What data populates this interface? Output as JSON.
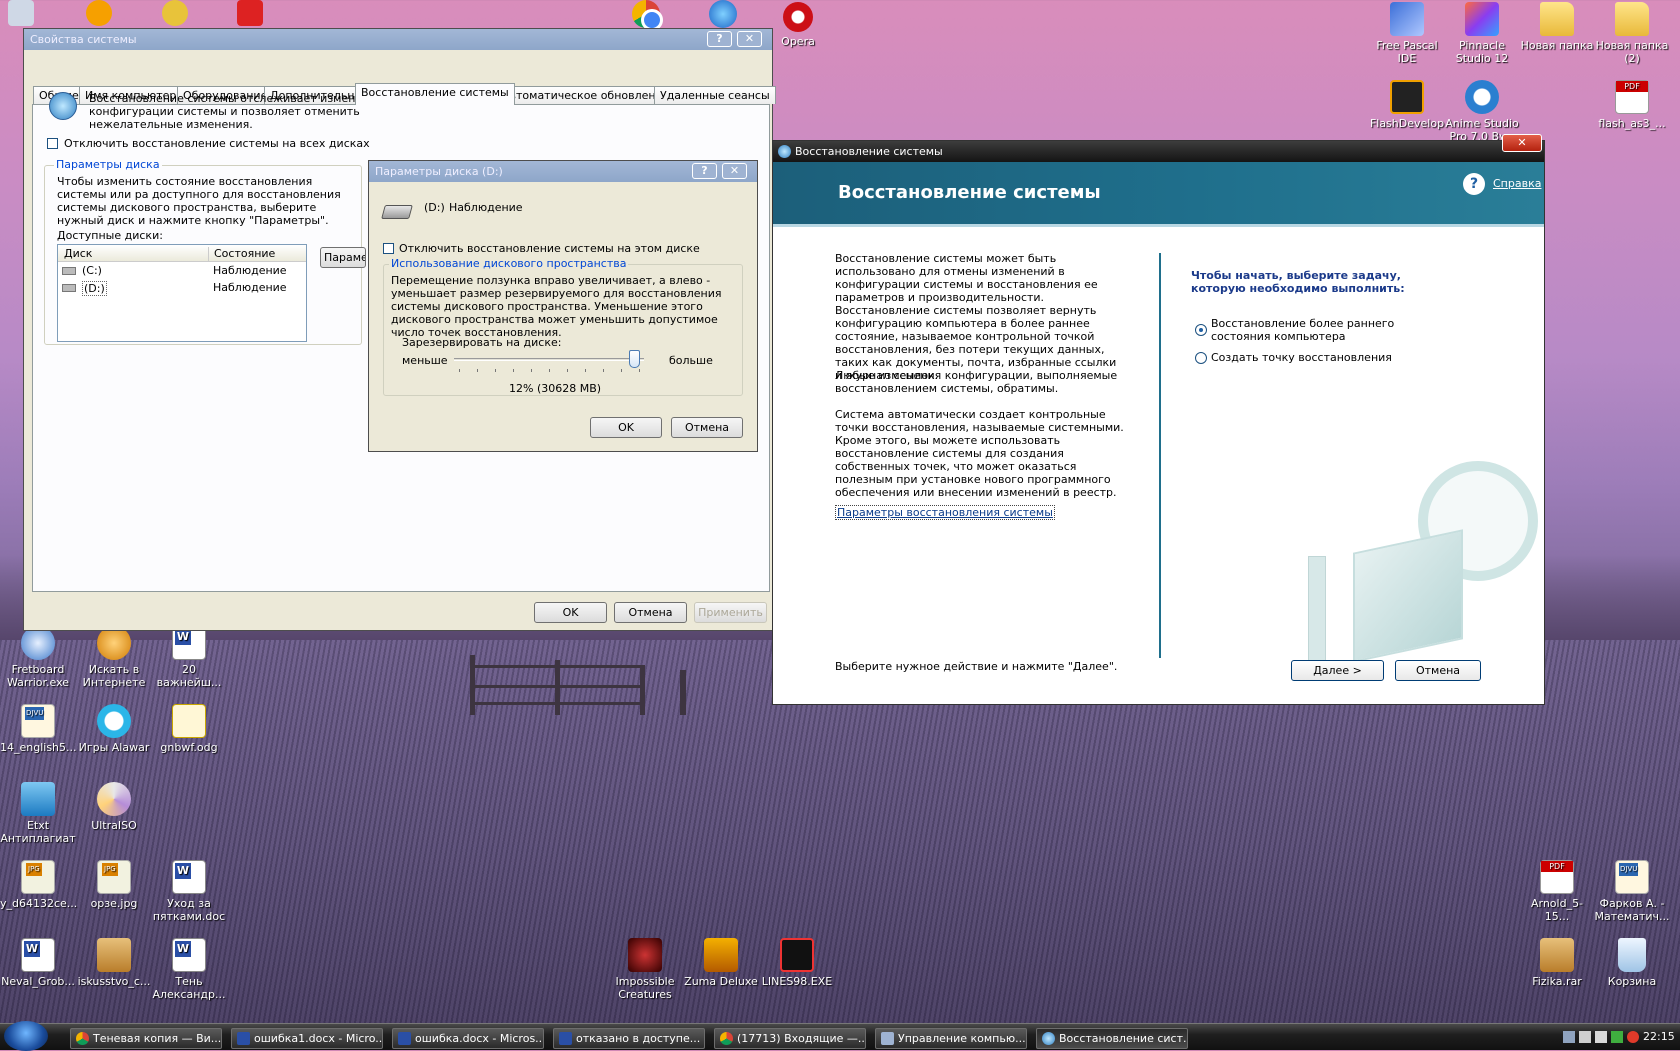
{
  "desktop": {
    "left_icons": [
      {
        "label": "Fretboard Warrior.exe",
        "icon": "guitar-icon"
      },
      {
        "label": "Искать в Интернете",
        "icon": "search-icon"
      },
      {
        "label": "20 важнейш...",
        "icon": "word-doc-icon"
      },
      {
        "label": "14_english5...",
        "icon": "djvu-icon"
      },
      {
        "label": "Игры Alawar",
        "icon": "alawar-icon"
      },
      {
        "label": "gnbwf.odg",
        "icon": "odg-icon"
      },
      {
        "label": "Etxt Антиплагиат",
        "icon": "etxt-icon"
      },
      {
        "label": "UltraISO",
        "icon": "disc-icon"
      },
      {
        "label": "y_d64132ce...",
        "icon": "jpg-icon"
      },
      {
        "label": "орзе.jpg",
        "icon": "jpg-icon"
      },
      {
        "label": "Уход за пятками.doc",
        "icon": "word-doc-icon"
      },
      {
        "label": "Neval_Grob...",
        "icon": "word-doc-icon"
      },
      {
        "label": "iskusstvo_c...",
        "icon": "rar-icon"
      },
      {
        "label": "Тень Александр...",
        "icon": "word-doc-icon"
      }
    ],
    "middle_icons": [
      {
        "label": "Impossible Creatures",
        "icon": "game-icon"
      },
      {
        "label": "Zuma Deluxe",
        "icon": "zuma-icon"
      },
      {
        "label": "LINES98.EXE",
        "icon": "lines-icon"
      }
    ],
    "top_icons": [
      {
        "label": "Opera",
        "icon": "opera-icon"
      }
    ],
    "right_icons": [
      {
        "label": "Free Pascal IDE",
        "icon": "pascal-icon"
      },
      {
        "label": "Pinnacle Studio 12",
        "icon": "pinnacle-icon"
      },
      {
        "label": "Новая папка",
        "icon": "folder-icon"
      },
      {
        "label": "Новая папка (2)",
        "icon": "folder-icon"
      },
      {
        "label": "FlashDevelop",
        "icon": "flashdevelop-icon"
      },
      {
        "label": "Anime Studio Pro 7.0 By...",
        "icon": "anime-studio-icon"
      },
      {
        "label": "flash_as3_...",
        "icon": "pdf-icon"
      },
      {
        "label": "Arnold_5-15...",
        "icon": "pdf-icon"
      },
      {
        "label": "Фарков А. - Математич...",
        "icon": "djvu-icon"
      },
      {
        "label": "Fizika.rar",
        "icon": "rar-icon"
      },
      {
        "label": "Корзина",
        "icon": "recycle-bin-icon"
      }
    ]
  },
  "sysprops": {
    "title": "Свойства системы",
    "tabs": [
      "Общие",
      "Имя компьютера",
      "Оборудование",
      "Дополнительно",
      "Восстановление системы",
      "Автоматическое обновление",
      "Удаленные сеансы"
    ],
    "intro": "Восстановление системы отслеживает изменения конфигурации системы и позволяет отменить нежелательные изменения.",
    "disable_all": "Отключить восстановление системы на всех дисках",
    "group_title": "Параметры диска",
    "group_text": "Чтобы изменить состояние восстановления системы или ра доступного для восстановления системы дискового пространства, выберите нужный диск и нажмите кнопку \"Параметры\".",
    "available_label": "Доступные диски:",
    "col_disk": "Диск",
    "col_state": "Состояние",
    "rows": [
      {
        "disk": "(C:)",
        "state": "Наблюдение"
      },
      {
        "disk": "(D:)",
        "state": "Наблюдение"
      }
    ],
    "params_btn": "Параметр",
    "ok": "OK",
    "cancel": "Отмена",
    "apply": "Применить"
  },
  "diskdlg": {
    "title": "Параметры диска (D:)",
    "drive": "(D:)",
    "drive_state": "Наблюдение",
    "disable": "Отключить восстановление системы на этом диске",
    "group_title": "Использование дискового пространства",
    "text": "Перемещение ползунка вправо увеличивает, а влево - уменьшает размер резервируемого для восстановления системы дискового пространства. Уменьшение этого дискового пространства может уменьшить допустимое число точек восстановления.",
    "reserve_label": "Зарезервировать на диске:",
    "less": "меньше",
    "more": "больше",
    "value_text": "12% (30628 MB)",
    "slider_fraction": 0.98,
    "ok": "OK",
    "cancel": "Отмена"
  },
  "wizard": {
    "title": "Восстановление системы",
    "header": "Восстановление системы",
    "help": "Справка",
    "p1": "Восстановление системы может быть использовано для отмены изменений в конфигурации системы и восстановления ее параметров и производительности. Восстановление системы позволяет вернуть конфигурацию компьютера в более раннее состояние, называемое контрольной точкой восстановления, без потери текущих данных, таких как документы, почта, избранные ссылки и журнал ссылок.",
    "p2": "Любые изменения конфигурации, выполняемые восстановлением системы, обратимы.",
    "p3": "Система автоматически создает контрольные точки восстановления, называемые системными. Кроме этого, вы можете использовать восстановление системы для создания собственных точек, что может оказаться полезным при установке нового программного обеспечения или внесении изменений в реестр.",
    "link": "Параметры восстановления системы",
    "task_prompt": "Чтобы начать, выберите задачу, которую необходимо выполнить:",
    "opt1": "Восстановление более раннего состояния компьютера",
    "opt2": "Создать точку восстановления",
    "footer": "Выберите нужное действие и нажмите \"Далее\".",
    "next": "Далее >",
    "cancel": "Отмена"
  },
  "taskbar": {
    "tasks": [
      "Теневая копия — Ви...",
      "ошибка1.docx - Micro...",
      "ошибка.docx - Micros...",
      "отказано в доступе...",
      "(17713) Входящие —...",
      "Управление компью...",
      "Восстановление сист..."
    ],
    "clock": "22:15"
  },
  "colors": {
    "xp_title": "#0a246a",
    "accent": "#1f5fa3",
    "wizard_band": "#1e6a84"
  }
}
